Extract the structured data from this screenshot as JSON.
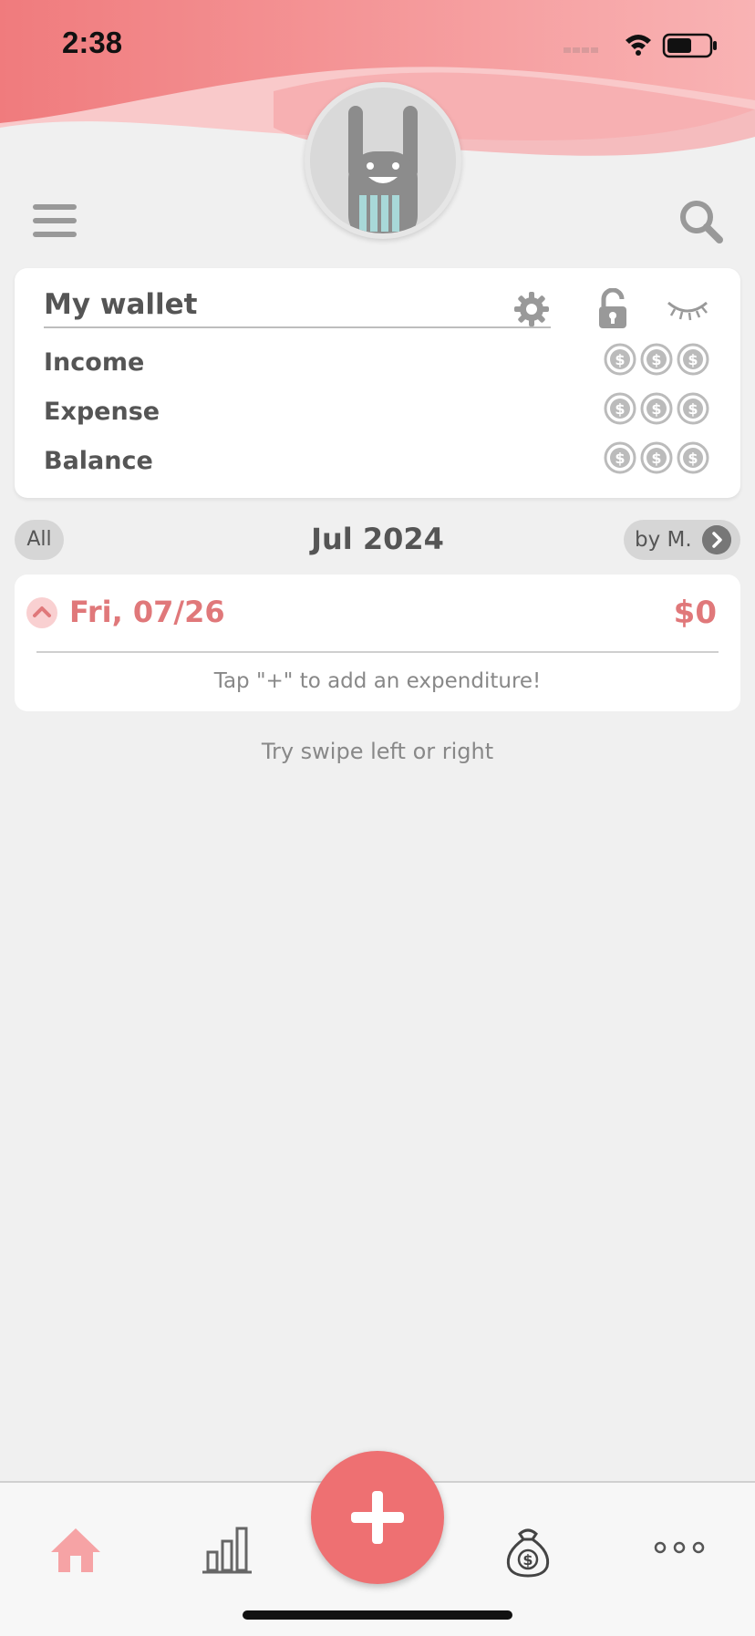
{
  "status_bar": {
    "time": "2:38"
  },
  "colors": {
    "accent": "#ee7072",
    "accent_text": "#e0787a",
    "background": "#f0f0f0"
  },
  "wallet": {
    "title": "My wallet",
    "rows": [
      {
        "label": "Income"
      },
      {
        "label": "Expense"
      },
      {
        "label": "Balance"
      }
    ]
  },
  "period": {
    "filter_all": "All",
    "month": "Jul 2024",
    "group_by": "by M."
  },
  "day": {
    "date": "Fri, 07/26",
    "total": "$0",
    "hint": "Tap \"+\" to add an expenditure!"
  },
  "swipe_hint": "Try swipe left or right",
  "icons": [
    "menu-icon",
    "search-icon",
    "gear-icon",
    "unlock-icon",
    "eye-closed-icon",
    "coin-icon",
    "chevron-right-icon",
    "chevron-up-icon",
    "home-icon",
    "chart-icon",
    "plus-icon",
    "money-bag-icon",
    "more-icon"
  ]
}
